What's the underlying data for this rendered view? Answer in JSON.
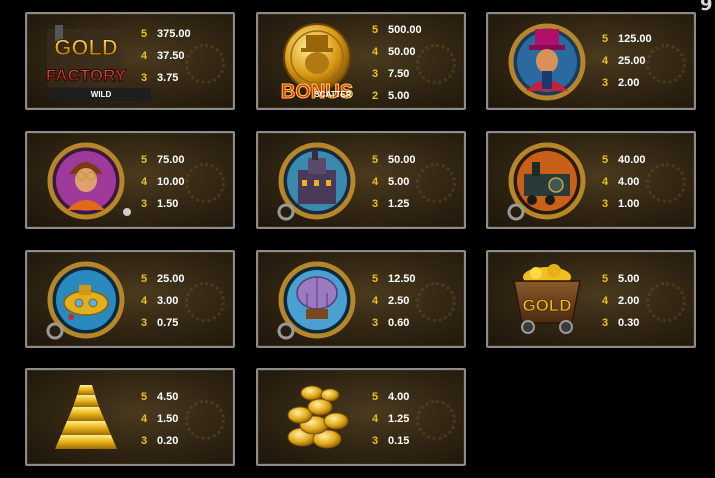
{
  "corner_glyph": "9",
  "colors": {
    "count": "#e8c21c",
    "value": "#ffffff",
    "border": "#8b8b8b",
    "panel": "#2f2412"
  },
  "symbols": [
    {
      "icon": "gold-factory-wild-logo",
      "logo": "GOLD FACTORY",
      "tag": "WILD",
      "pays": [
        {
          "count": "5",
          "value": "375.00"
        },
        {
          "count": "4",
          "value": "37.50"
        },
        {
          "count": "3",
          "value": "3.75"
        }
      ]
    },
    {
      "icon": "bonus-scatter-coin",
      "logo": "BONUS",
      "tag": "SCATTER",
      "pays": [
        {
          "count": "5",
          "value": "500.00"
        },
        {
          "count": "4",
          "value": "50.00"
        },
        {
          "count": "3",
          "value": "7.50"
        },
        {
          "count": "2",
          "value": "5.00"
        }
      ]
    },
    {
      "icon": "ringmaster-portrait",
      "pays": [
        {
          "count": "5",
          "value": "125.00"
        },
        {
          "count": "4",
          "value": "25.00"
        },
        {
          "count": "3",
          "value": "2.00"
        }
      ]
    },
    {
      "icon": "girl-with-goggles-portrait",
      "pays": [
        {
          "count": "5",
          "value": "75.00"
        },
        {
          "count": "4",
          "value": "10.00"
        },
        {
          "count": "3",
          "value": "1.50"
        }
      ]
    },
    {
      "icon": "factory-building",
      "pays": [
        {
          "count": "5",
          "value": "50.00"
        },
        {
          "count": "4",
          "value": "5.00"
        },
        {
          "count": "3",
          "value": "1.25"
        }
      ]
    },
    {
      "icon": "steam-train",
      "pays": [
        {
          "count": "5",
          "value": "40.00"
        },
        {
          "count": "4",
          "value": "4.00"
        },
        {
          "count": "3",
          "value": "1.00"
        }
      ]
    },
    {
      "icon": "submarine",
      "pays": [
        {
          "count": "5",
          "value": "25.00"
        },
        {
          "count": "4",
          "value": "3.00"
        },
        {
          "count": "3",
          "value": "0.75"
        }
      ]
    },
    {
      "icon": "airship-balloon",
      "pays": [
        {
          "count": "5",
          "value": "12.50"
        },
        {
          "count": "4",
          "value": "2.50"
        },
        {
          "count": "3",
          "value": "0.60"
        }
      ]
    },
    {
      "icon": "gold-mine-cart",
      "logo": "GOLD",
      "pays": [
        {
          "count": "5",
          "value": "5.00"
        },
        {
          "count": "4",
          "value": "2.00"
        },
        {
          "count": "3",
          "value": "0.30"
        }
      ]
    },
    {
      "icon": "gold-bar-stack",
      "pays": [
        {
          "count": "5",
          "value": "4.50"
        },
        {
          "count": "4",
          "value": "1.50"
        },
        {
          "count": "3",
          "value": "0.20"
        }
      ]
    },
    {
      "icon": "gold-coin-pile",
      "pays": [
        {
          "count": "5",
          "value": "4.00"
        },
        {
          "count": "4",
          "value": "1.25"
        },
        {
          "count": "3",
          "value": "0.15"
        }
      ]
    }
  ]
}
